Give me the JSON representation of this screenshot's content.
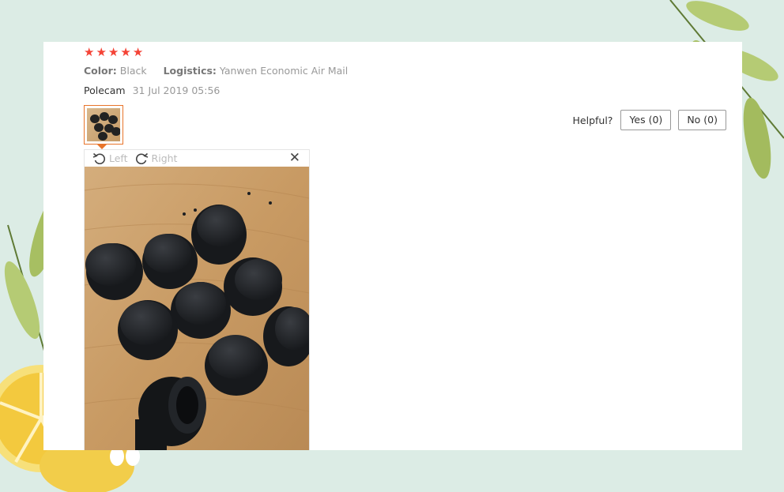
{
  "review": {
    "rating": 5,
    "stars": [
      "★",
      "★",
      "★",
      "★",
      "★"
    ],
    "color_label": "Color:",
    "color_value": "Black",
    "logistics_label": "Logistics:",
    "logistics_value": "Yanwen Economic Air Mail",
    "author": "Polecam",
    "date": "31 Jul 2019 05:56"
  },
  "helpful": {
    "label": "Helpful?",
    "yes_label": "Yes (0)",
    "no_label": "No (0)"
  },
  "viewer": {
    "rotate_left_label": "Left",
    "rotate_right_label": "Right",
    "close_glyph": "✕"
  },
  "colors": {
    "star": "#f44336",
    "accent": "#e8742a",
    "background": "#dcece5"
  }
}
